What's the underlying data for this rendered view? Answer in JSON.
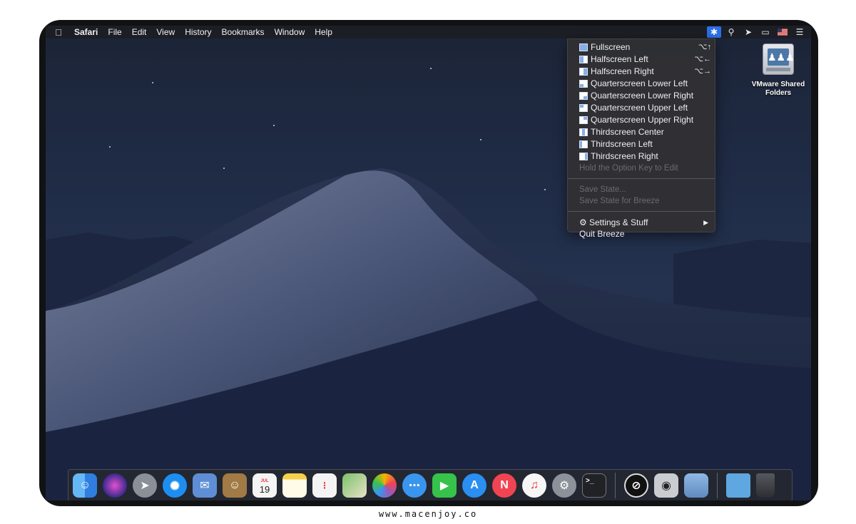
{
  "menubar": {
    "apple_icon": "apple-logo-icon",
    "app_name": "Safari",
    "menus": [
      "File",
      "Edit",
      "View",
      "History",
      "Bookmarks",
      "Window",
      "Help"
    ],
    "status_icons": [
      "breeze-icon",
      "spotlight-search-icon",
      "location-icon",
      "display-mirroring-icon",
      "us-flag-input-icon",
      "notification-center-icon"
    ]
  },
  "breeze_menu": {
    "layouts": [
      {
        "label": "Fullscreen",
        "shortcut": "⌥↑"
      },
      {
        "label": "Halfscreen Left",
        "shortcut": "⌥←"
      },
      {
        "label": "Halfscreen Right",
        "shortcut": "⌥→"
      },
      {
        "label": "Quarterscreen Lower Left",
        "shortcut": ""
      },
      {
        "label": "Quarterscreen Lower Right",
        "shortcut": ""
      },
      {
        "label": "Quarterscreen Upper Left",
        "shortcut": ""
      },
      {
        "label": "Quarterscreen Upper Right",
        "shortcut": ""
      },
      {
        "label": "Thirdscreen Center",
        "shortcut": ""
      },
      {
        "label": "Thirdscreen Left",
        "shortcut": ""
      },
      {
        "label": "Thirdscreen Right",
        "shortcut": ""
      }
    ],
    "hint": "Hold the Option Key to Edit",
    "save_state": "Save State...",
    "save_state_breeze": "Save State for Breeze",
    "settings": "Settings & Stuff",
    "quit": "Quit Breeze"
  },
  "desktop": {
    "drive_label_line1": "VMware Shared",
    "drive_label_line2": "Folders"
  },
  "dock": {
    "apps": [
      {
        "name": "finder-icon",
        "color": "#3a8ee6"
      },
      {
        "name": "siri-icon",
        "color": "#7a3fd1"
      },
      {
        "name": "launchpad-icon",
        "color": "#8a8f98"
      },
      {
        "name": "safari-icon",
        "color": "#1d8ef0"
      },
      {
        "name": "mail-icon",
        "color": "#5e8fd6"
      },
      {
        "name": "contacts-icon",
        "color": "#a27a45"
      },
      {
        "name": "calendar-icon",
        "color": "#f4f4f4"
      },
      {
        "name": "notes-icon",
        "color": "#f5d04a"
      },
      {
        "name": "reminders-icon",
        "color": "#f4f4f4"
      },
      {
        "name": "maps-icon",
        "color": "#7cc269"
      },
      {
        "name": "photos-icon",
        "color": "#f2f2f2"
      },
      {
        "name": "messages-icon",
        "color": "#3a95ef"
      },
      {
        "name": "facetime-icon",
        "color": "#36c24b"
      },
      {
        "name": "app-store-icon",
        "color": "#2a8ff0"
      },
      {
        "name": "news-icon",
        "color": "#f04452"
      },
      {
        "name": "itunes-icon",
        "color": "#f6f6f6"
      },
      {
        "name": "system-preferences-icon",
        "color": "#8d9199"
      },
      {
        "name": "terminal-icon",
        "color": "#202226"
      },
      {
        "name": "breeze-app-icon",
        "color": "#111111"
      },
      {
        "name": "midi-setup-icon",
        "color": "#c9ccd1"
      },
      {
        "name": "preview-icon",
        "color": "#5f8bbd"
      },
      {
        "name": "downloads-folder-icon",
        "color": "#5fa7e0"
      },
      {
        "name": "trash-icon",
        "color": "#3a3c40"
      }
    ],
    "calendar_month": "JUL",
    "calendar_day": "19"
  },
  "watermark": "www.macenjoy.co"
}
